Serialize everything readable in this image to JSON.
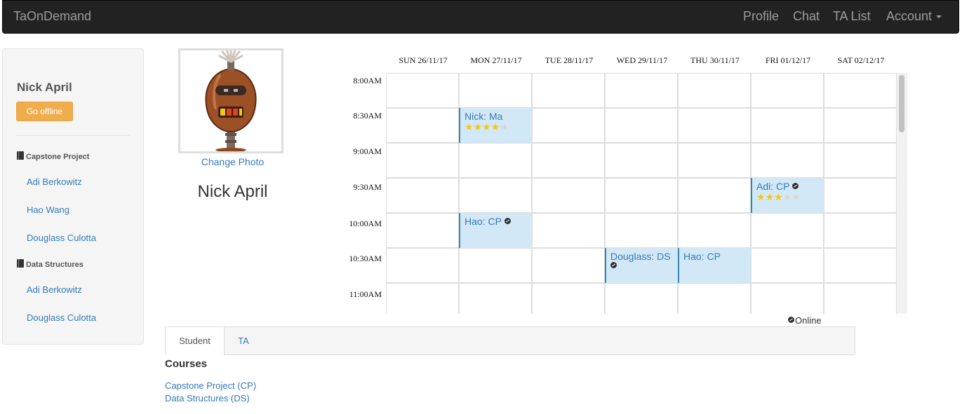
{
  "navbar": {
    "brand": "TaOnDemand",
    "links": [
      "Profile",
      "Chat",
      "TA List",
      "Account"
    ]
  },
  "sidebar": {
    "user_name": "Nick April",
    "status_button": "Go offline",
    "groups": [
      {
        "title": "Capstone Project",
        "members": [
          "Adi Berkowitz",
          "Hao Wang",
          "Douglass Culotta"
        ]
      },
      {
        "title": "Data Structures",
        "members": [
          "Adi Berkowitz",
          "Douglass Culotta"
        ]
      }
    ]
  },
  "profile": {
    "change_photo": "Change Photo",
    "name": "Nick April"
  },
  "calendar": {
    "days": [
      "SUN 26/11/17",
      "MON 27/11/17",
      "TUE 28/11/17",
      "WED 29/11/17",
      "THU 30/11/17",
      "FRI 01/12/17",
      "SAT 02/12/17"
    ],
    "times": [
      "8:00AM",
      "8:30AM",
      "9:00AM",
      "9:30AM",
      "10:00AM",
      "10:30AM",
      "11:00AM"
    ],
    "events": [
      {
        "title": "Nick: Ma",
        "day": "MON 27/11/17",
        "time": "8:30AM",
        "rating": 4,
        "online": false
      },
      {
        "title": "Adi: CP",
        "day": "FRI 01/12/17",
        "time": "9:30AM",
        "rating": 3,
        "online": true
      },
      {
        "title": "Hao: CP",
        "day": "MON 27/11/17",
        "time": "10:00AM",
        "rating": null,
        "online": true
      },
      {
        "title": "Douglass: DS",
        "day": "WED 29/11/17",
        "time": "10:30AM",
        "rating": null,
        "online": true
      },
      {
        "title": "Hao: CP",
        "day": "THU 30/11/17",
        "time": "10:30AM",
        "rating": null,
        "online": false
      }
    ],
    "legend": "Online"
  },
  "tabs": [
    "Student",
    "TA"
  ],
  "active_tab": "Student",
  "courses": {
    "title": "Courses",
    "items": [
      "Capstone Project (CP)",
      "Data Structures (DS)"
    ]
  },
  "colors": {
    "navbar_bg": "#222222",
    "warning_button": "#f0ad4e",
    "link": "#337ab7",
    "event_bg": "#d3e8f6",
    "star_on": "#f5c518"
  }
}
